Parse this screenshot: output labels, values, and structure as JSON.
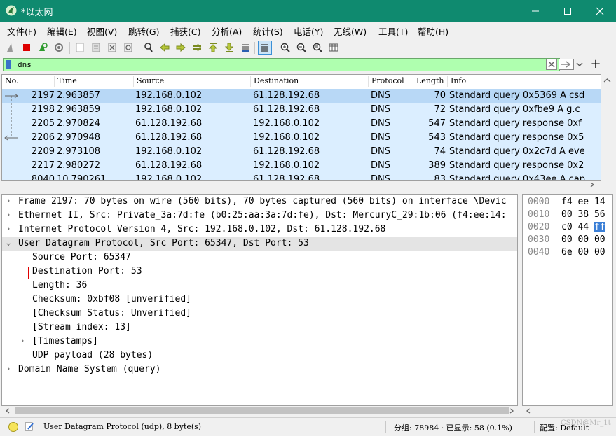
{
  "window": {
    "title": "*以太网",
    "controls": {
      "minimize": "—",
      "maximize": "☐",
      "close": "✕"
    }
  },
  "menu": [
    "文件(F)",
    "编辑(E)",
    "视图(V)",
    "跳转(G)",
    "捕获(C)",
    "分析(A)",
    "统计(S)",
    "电话(Y)",
    "无线(W)",
    "工具(T)",
    "帮助(H)"
  ],
  "toolbar": {
    "icons": [
      "shark-fin-start-icon",
      "stop-capture-icon",
      "restart-capture-icon",
      "capture-options-icon",
      "open-file-icon",
      "save-file-icon",
      "close-file-icon",
      "reload-file-icon",
      "find-packet-icon",
      "go-back-icon",
      "go-forward-icon",
      "go-to-packet-icon",
      "first-packet-icon",
      "last-packet-icon",
      "auto-scroll-icon",
      "colorize-icon",
      "zoom-in-icon",
      "zoom-out-icon",
      "normal-size-icon",
      "resize-columns-icon"
    ]
  },
  "filter": {
    "value": "dns",
    "add_label": "+"
  },
  "packet_list": {
    "columns": [
      "No.",
      "Time",
      "Source",
      "Destination",
      "Protocol",
      "Length",
      "Info"
    ],
    "rows": [
      {
        "no": "2197",
        "time": "2.963857",
        "src": "192.168.0.102",
        "dst": "61.128.192.68",
        "proto": "DNS",
        "len": "70",
        "info": "Standard query 0x5369 A csd"
      },
      {
        "no": "2198",
        "time": "2.963859",
        "src": "192.168.0.102",
        "dst": "61.128.192.68",
        "proto": "DNS",
        "len": "72",
        "info": "Standard query 0xfbe9 A g.c"
      },
      {
        "no": "2205",
        "time": "2.970824",
        "src": "61.128.192.68",
        "dst": "192.168.0.102",
        "proto": "DNS",
        "len": "547",
        "info": "Standard query response 0xf"
      },
      {
        "no": "2206",
        "time": "2.970948",
        "src": "61.128.192.68",
        "dst": "192.168.0.102",
        "proto": "DNS",
        "len": "543",
        "info": "Standard query response 0x5"
      },
      {
        "no": "2209",
        "time": "2.973108",
        "src": "192.168.0.102",
        "dst": "61.128.192.68",
        "proto": "DNS",
        "len": "74",
        "info": "Standard query 0x2c7d A eve"
      },
      {
        "no": "2217",
        "time": "2.980272",
        "src": "61.128.192.68",
        "dst": "192.168.0.102",
        "proto": "DNS",
        "len": "389",
        "info": "Standard query response 0x2"
      },
      {
        "no": "8040",
        "time": "10.790261",
        "src": "192.168.0.102",
        "dst": "61.128.192.68",
        "proto": "DNS",
        "len": "83",
        "info": "Standard query 0x43ee A cap"
      }
    ]
  },
  "details": [
    {
      "text": "Frame 2197: 70 bytes on wire (560 bits), 70 bytes captured (560 bits) on interface \\Devic",
      "arrow": "›"
    },
    {
      "text": "Ethernet II, Src: Private_3a:7d:fe (b0:25:aa:3a:7d:fe), Dst: MercuryC_29:1b:06 (f4:ee:14:",
      "arrow": "›"
    },
    {
      "text": "Internet Protocol Version 4, Src: 192.168.0.102, Dst: 61.128.192.68",
      "arrow": "›"
    },
    {
      "text": "User Datagram Protocol, Src Port: 65347, Dst Port: 53",
      "arrow": "⌄"
    },
    {
      "text": "Source Port: 65347",
      "arrow": ""
    },
    {
      "text": "Destination Port: 53",
      "arrow": ""
    },
    {
      "text": "Length: 36",
      "arrow": ""
    },
    {
      "text": "Checksum: 0xbf08 [unverified]",
      "arrow": ""
    },
    {
      "text": "[Checksum Status: Unverified]",
      "arrow": ""
    },
    {
      "text": "[Stream index: 13]",
      "arrow": ""
    },
    {
      "text": "[Timestamps]",
      "arrow": "›"
    },
    {
      "text": "UDP payload (28 bytes)",
      "arrow": ""
    },
    {
      "text": "Domain Name System (query)",
      "arrow": "›"
    }
  ],
  "bytes": [
    {
      "offset": "0000",
      "hex_a": "f4 ee 14",
      "hex_b": ""
    },
    {
      "offset": "0010",
      "hex_a": "00 38 56",
      "hex_b": ""
    },
    {
      "offset": "0020",
      "hex_a": "c0 44 ",
      "hex_b": "ff"
    },
    {
      "offset": "0030",
      "hex_a": "00 00 00",
      "hex_b": ""
    },
    {
      "offset": "0040",
      "hex_a": "6e 00 00",
      "hex_b": ""
    }
  ],
  "status": {
    "field_info": "User Datagram Protocol (udp), 8 byte(s)",
    "packets": "分组: 78984 · 已显示: 58 (0.1%)",
    "profile": "配置: Default",
    "watermark": "CSDN@Mr_1t"
  }
}
